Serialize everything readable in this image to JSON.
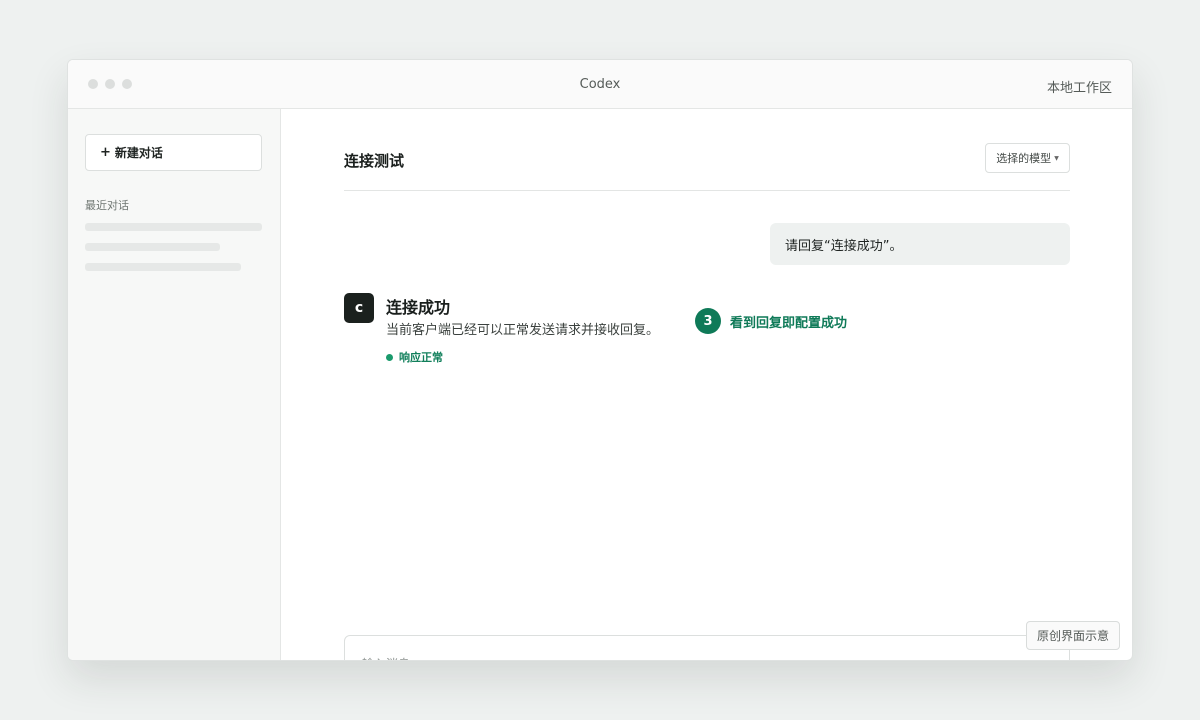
{
  "window": {
    "title": "Codex",
    "workspace": "本地工作区"
  },
  "sidebar": {
    "new_chat_label": "新建对话",
    "new_chat_icon": "plus-icon",
    "recent_label": "最近对话"
  },
  "header": {
    "title": "连接测试",
    "model_select_label": "选择的模型",
    "model_select_icon": "chevron-down-icon"
  },
  "conversation": {
    "user_message": "请回复“连接成功”。",
    "assistant": {
      "avatar_letter": "c",
      "title": "连接成功",
      "body": "当前客户端已经可以正常发送请求并接收回复。",
      "status": "响应正常"
    },
    "step": {
      "number": "3",
      "text": "看到回复即配置成功"
    }
  },
  "composer": {
    "placeholder": "输入消息..."
  },
  "badge": "原创界面示意",
  "colors": {
    "accent": "#0f7a58",
    "status_dot": "#1a9a6c",
    "avatar_bg": "#1b211e",
    "user_bubble_bg": "#eef1f0",
    "page_bg": "#eef1f0"
  }
}
